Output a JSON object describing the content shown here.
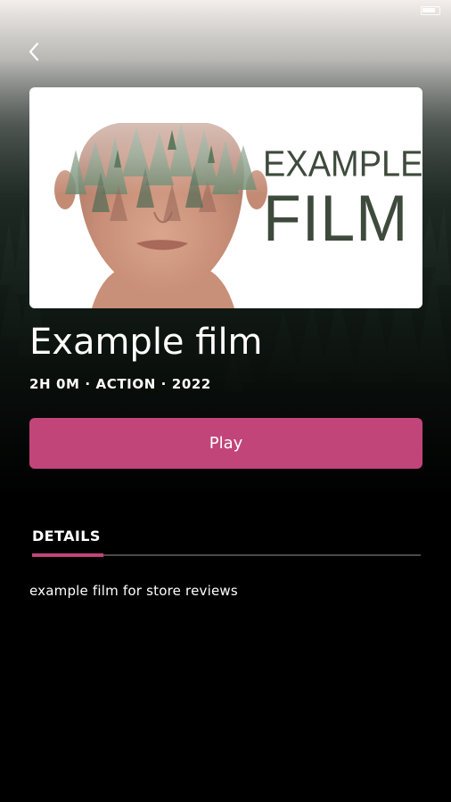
{
  "status_bar": {
    "time": "",
    "left": ""
  },
  "navigation": {
    "back_icon": "chevron-left-icon"
  },
  "poster": {
    "title_line1": "EXAMPLE",
    "title_line2": "FILM"
  },
  "movie": {
    "title": "Example film",
    "meta": "2H 0M · ACTION · 2022"
  },
  "actions": {
    "play_label": "Play"
  },
  "tabs": [
    {
      "label": "DETAILS",
      "active": true
    }
  ],
  "details": {
    "description": "example film for store reviews"
  },
  "colors": {
    "accent": "#c2457a",
    "background": "#000000",
    "tab_track": "#4a4a4a",
    "poster_text": "#3e4a3c"
  }
}
